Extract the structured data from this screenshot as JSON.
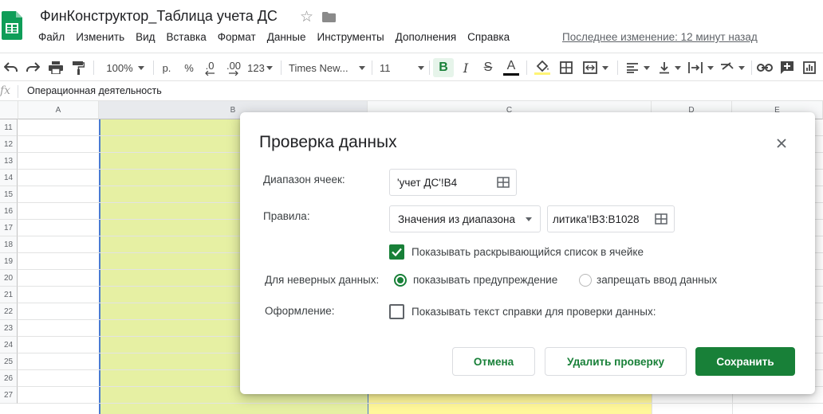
{
  "app": {
    "doc_title": "ФинКонструктор_Таблица учета ДС",
    "last_edit": "Последнее изменение: 12 минут назад",
    "menu": [
      "Файл",
      "Изменить",
      "Вид",
      "Вставка",
      "Формат",
      "Данные",
      "Инструменты",
      "Дополнения",
      "Справка"
    ]
  },
  "toolbar": {
    "zoom": "100%",
    "currency": "р.",
    "percent": "%",
    "decimal_less": ".0",
    "decimal_more": ".00",
    "more_formats": "123",
    "font": "Times New...",
    "font_size": "11",
    "bold": "B",
    "italic": "I",
    "strike": "S",
    "text_color": "A"
  },
  "formula_bar": {
    "fx": "fx",
    "value": "Операционная деятельность"
  },
  "sheet": {
    "columns": [
      "A",
      "B",
      "C",
      "D",
      "E"
    ],
    "rows": [
      "11",
      "12",
      "13",
      "14",
      "15",
      "16",
      "17",
      "18",
      "19",
      "20",
      "21",
      "22",
      "23",
      "24",
      "25",
      "26",
      "27"
    ],
    "colors": {
      "col_b_fill": "#e6f0a3",
      "col_c_fill": "#fff79a"
    }
  },
  "dialog": {
    "title": "Проверка данных",
    "range_label": "Диапазон ячеек:",
    "range_value": "'учет ДС'!B4",
    "rules_label": "Правила:",
    "rule_type": "Значения из диапазона",
    "rule_range": "литика'!B3:B1028",
    "show_dropdown_label": "Показывать раскрывающийся список в ячейке",
    "show_dropdown_checked": true,
    "invalid_label": "Для неверных данных:",
    "invalid_warn": "показывать предупреждение",
    "invalid_reject": "запрещать ввод данных",
    "invalid_selected": "warn",
    "appearance_label": "Оформление:",
    "help_text_label": "Показывать текст справки для проверки данных:",
    "help_text_checked": false,
    "cancel": "Отмена",
    "remove": "Удалить проверку",
    "save": "Сохранить",
    "accent_color": "#188038"
  }
}
